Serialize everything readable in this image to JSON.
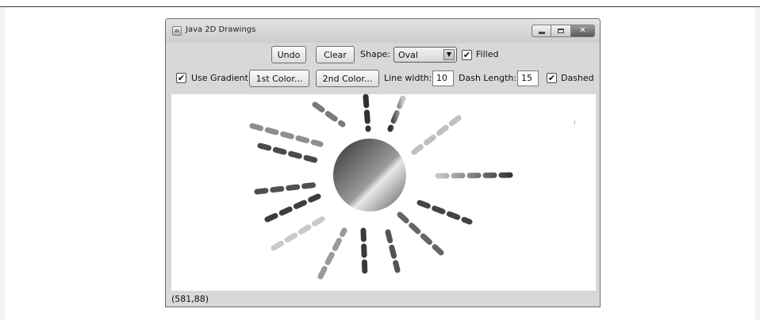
{
  "window": {
    "title": "Java 2D Drawings",
    "icon": "java-app-icon",
    "controls": [
      "minimize-icon",
      "maximize-icon",
      "close-icon"
    ]
  },
  "toolbar1": {
    "undo_label": "Undo",
    "clear_label": "Clear",
    "shape_label": "Shape:",
    "shape_value": "Oval",
    "filled_label": "Filled",
    "filled_checked": true
  },
  "toolbar2": {
    "use_gradient_label": "Use Gradient",
    "use_gradient_checked": true,
    "color1_label": "1st Color...",
    "color2_label": "2nd Color...",
    "line_width_label": "Line width:",
    "line_width_value": "10",
    "dash_length_label": "Dash Length:",
    "dash_length_value": "15",
    "dashed_label": "Dashed",
    "dashed_checked": true
  },
  "status": {
    "mouse_position": "(581,88)"
  },
  "colors": {
    "window_bg": "#d8d8d8",
    "canvas_bg": "#ffffff",
    "gradient_dark": "#3a3a3a",
    "gradient_light": "#e6e6e6"
  }
}
